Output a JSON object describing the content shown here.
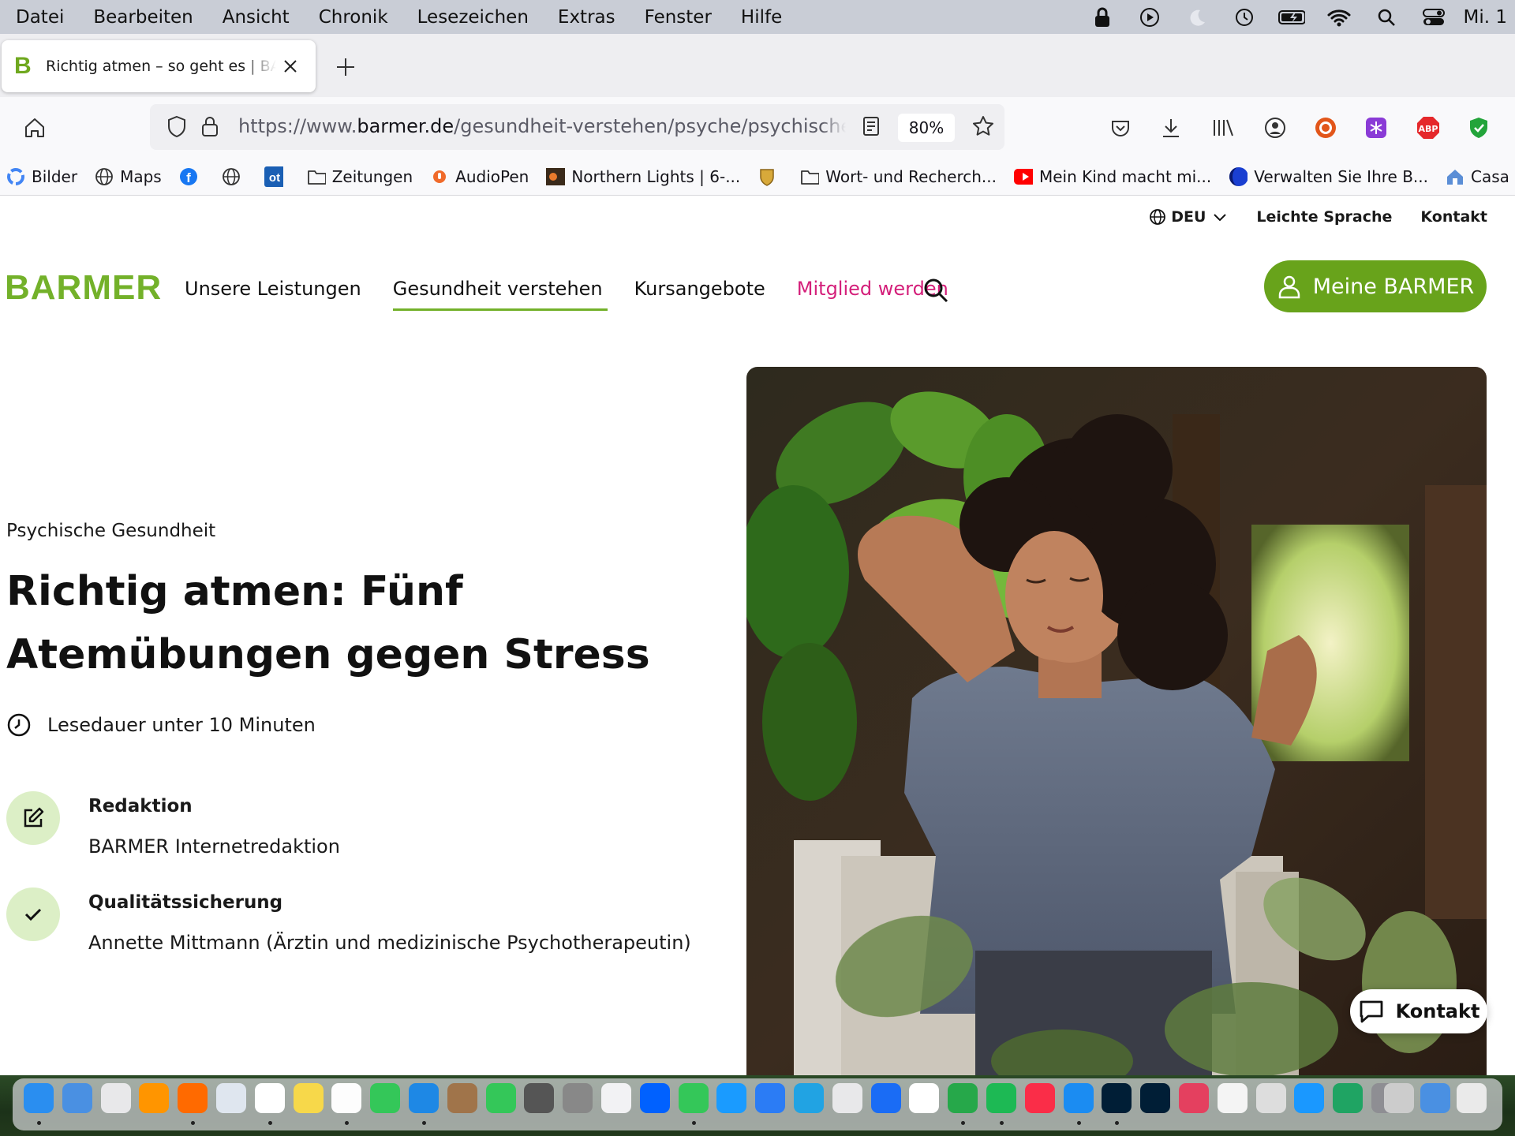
{
  "menubar": {
    "items": [
      "Datei",
      "Bearbeiten",
      "Ansicht",
      "Chronik",
      "Lesezeichen",
      "Extras",
      "Fenster",
      "Hilfe"
    ],
    "clock": "Mi. 1"
  },
  "tab": {
    "title": "Richtig atmen – so geht es | BARMER",
    "favicon_letter": "B"
  },
  "navbar": {
    "url_prefix": "https://www.",
    "url_domain": "barmer.de",
    "url_path": "/gesundheit-verstehen/psyche/psychische-gesundheit",
    "zoom": "80%"
  },
  "bookmarks": [
    {
      "label": "Bilder",
      "icon": "google-icon"
    },
    {
      "label": "Maps",
      "icon": "globe-icon"
    },
    {
      "label": "",
      "icon": "facebook-icon"
    },
    {
      "label": "",
      "icon": "globe-icon"
    },
    {
      "label": "",
      "icon": "ot-icon"
    },
    {
      "label": "Zeitungen",
      "icon": "folder-icon"
    },
    {
      "label": "AudioPen",
      "icon": "audiopen-icon"
    },
    {
      "label": "Northern Lights | 6-...",
      "icon": "image-icon"
    },
    {
      "label": "",
      "icon": "shield-crest-icon"
    },
    {
      "label": "Wort- und Recherch...",
      "icon": "folder-icon"
    },
    {
      "label": "Mein Kind macht mi...",
      "icon": "youtube-icon"
    },
    {
      "label": "Verwalten Sie Ihre B...",
      "icon": "blue-circle-icon"
    },
    {
      "label": "Casa Clara",
      "icon": "house-icon"
    }
  ],
  "page": {
    "utility": {
      "language": "DEU",
      "easy_language": "Leichte Sprache",
      "contact": "Kontakt"
    },
    "logo": "BARMER",
    "nav": [
      "Unsere Leistungen",
      "Gesundheit verstehen",
      "Kursangebote",
      "Mitglied werden"
    ],
    "cta_button": "Meine BARMER",
    "breadcrumb": "Psychische Gesundheit",
    "headline": "Richtig atmen: Fünf Atemübungen gegen Stress",
    "read_time": "Lesedauer unter 10 Minuten",
    "meta": [
      {
        "label": "Redaktion",
        "value": "BARMER Internetredaktion",
        "icon": "pencil-icon"
      },
      {
        "label": "Qualitätssicherung",
        "value": "Annette Mittmann (Ärztin und medizinische Psychotherapeutin)",
        "icon": "checkmark-icon"
      }
    ],
    "floating_contact": "Kontakt"
  },
  "colors": {
    "brand_green": "#73b12a",
    "button_green": "#68a31b",
    "accent_pink": "#d41f7a",
    "soft_green": "#dcefc6"
  }
}
